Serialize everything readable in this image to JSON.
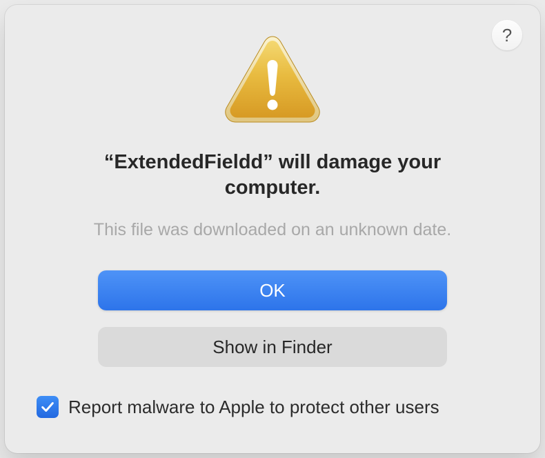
{
  "dialog": {
    "help_label": "?",
    "app_name": "ExtendedFieldd",
    "headline_prefix": "“",
    "headline_suffix": "” will damage your computer.",
    "subtext": "This file was downloaded on an unknown date.",
    "ok_label": "OK",
    "show_in_finder_label": "Show in Finder",
    "report_checkbox_label": "Report malware to Apple to protect other users",
    "report_checked": true
  }
}
